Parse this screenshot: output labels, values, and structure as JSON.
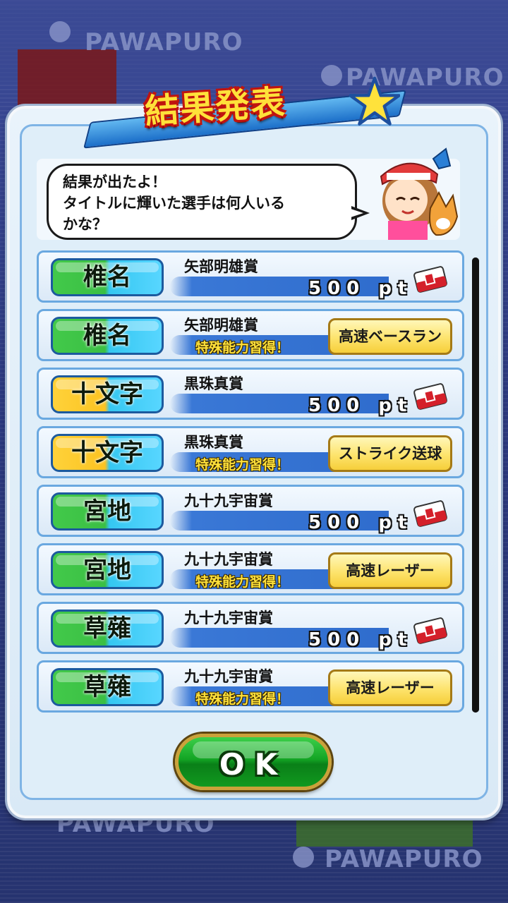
{
  "title": "結果発表",
  "message": {
    "line1": "結果が出たよ！",
    "line2": "タイトルに輝いた選手は何人いる",
    "line3": "かな？"
  },
  "background_text": "PAWAPURO",
  "results": [
    {
      "player": "椎名",
      "color": "green",
      "award": "矢部明雄賞",
      "reward_type": "points",
      "points": "500 pt"
    },
    {
      "player": "椎名",
      "color": "green",
      "award": "矢部明雄賞",
      "reward_type": "skill",
      "note": "特殊能力習得！",
      "skill": "高速ベースラン"
    },
    {
      "player": "十文字",
      "color": "yellow",
      "award": "黒珠真賞",
      "reward_type": "points",
      "points": "500 pt"
    },
    {
      "player": "十文字",
      "color": "yellow",
      "award": "黒珠真賞",
      "reward_type": "skill",
      "note": "特殊能力習得！",
      "skill": "ストライク送球"
    },
    {
      "player": "宮地",
      "color": "green",
      "award": "九十九宇宙賞",
      "reward_type": "points",
      "points": "500 pt"
    },
    {
      "player": "宮地",
      "color": "green",
      "award": "九十九宇宙賞",
      "reward_type": "skill",
      "note": "特殊能力習得！",
      "skill": "高速レーザー"
    },
    {
      "player": "草薙",
      "color": "green",
      "award": "九十九宇宙賞",
      "reward_type": "points",
      "points": "500 pt"
    },
    {
      "player": "草薙",
      "color": "green",
      "award": "九十九宇宙賞",
      "reward_type": "skill",
      "note": "特殊能力習得！",
      "skill": "高速レーザー"
    }
  ],
  "ok_button": "OK",
  "colors": {
    "accent_title": "#ffe13a",
    "ok_green": "#13a424",
    "bar_blue": "#2f6ccd"
  }
}
